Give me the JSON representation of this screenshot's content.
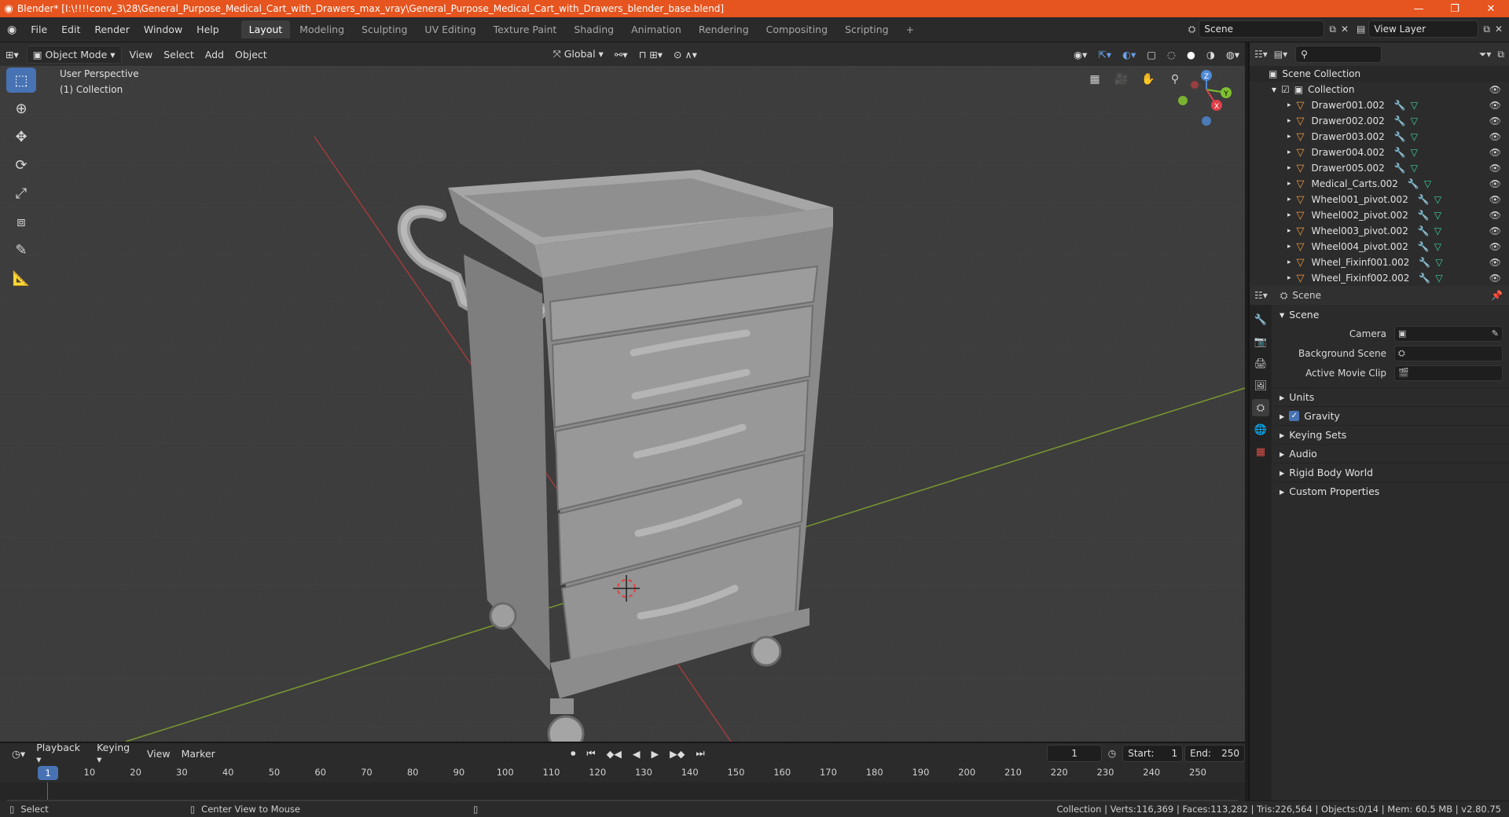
{
  "window": {
    "title": "Blender* [I:\\!!!!conv_3\\28\\General_Purpose_Medical_Cart_with_Drawers_max_vray\\General_Purpose_Medical_Cart_with_Drawers_blender_base.blend]",
    "controls": {
      "minimize": "—",
      "maximize": "❐",
      "close": "✕"
    }
  },
  "menu": [
    "File",
    "Edit",
    "Render",
    "Window",
    "Help"
  ],
  "workspaces": [
    "Layout",
    "Modeling",
    "Sculpting",
    "UV Editing",
    "Texture Paint",
    "Shading",
    "Animation",
    "Rendering",
    "Compositing",
    "Scripting"
  ],
  "active_workspace": "Layout",
  "add_workspace": "+",
  "scene_field": "Scene",
  "view_layer_field": "View Layer",
  "viewport_header": {
    "mode": "Object Mode",
    "menus": [
      "View",
      "Select",
      "Add",
      "Object"
    ],
    "orientation": "Global"
  },
  "viewport": {
    "perspective": "User Perspective",
    "collection": "(1) Collection",
    "gizmo": {
      "x": "X",
      "y": "Y",
      "z": "Z"
    }
  },
  "outliner": {
    "search_placeholder": "",
    "scene_collection": "Scene Collection",
    "collection": "Collection",
    "objects": [
      "Drawer001.002",
      "Drawer002.002",
      "Drawer003.002",
      "Drawer004.002",
      "Drawer005.002",
      "Medical_Carts.002",
      "Wheel001_pivot.002",
      "Wheel002_pivot.002",
      "Wheel003_pivot.002",
      "Wheel004_pivot.002",
      "Wheel_Fixinf001.002",
      "Wheel_Fixinf002.002"
    ]
  },
  "properties": {
    "header": "Scene",
    "panel": "Scene",
    "camera_label": "Camera",
    "background_scene_label": "Background Scene",
    "active_movie_clip_label": "Active Movie Clip",
    "subpanels": [
      "Units",
      "Gravity",
      "Keying Sets",
      "Audio",
      "Rigid Body World",
      "Custom Properties"
    ],
    "gravity_checked": true
  },
  "timeline": {
    "menus": [
      "Playback",
      "Keying",
      "View",
      "Marker"
    ],
    "current_frame": "1",
    "start_label": "Start:",
    "start": "1",
    "end_label": "End:",
    "end": "250",
    "ticks": [
      "1",
      "10",
      "20",
      "30",
      "40",
      "50",
      "60",
      "70",
      "80",
      "90",
      "100",
      "110",
      "120",
      "130",
      "140",
      "150",
      "160",
      "170",
      "180",
      "190",
      "200",
      "210",
      "220",
      "230",
      "240",
      "250"
    ]
  },
  "statusbar": {
    "select": "Select",
    "center_view": "Center View to Mouse",
    "stats": "Collection | Verts:116,369 | Faces:113,282 | Tris:226,564 | Objects:0/14 | Mem: 60.5 MB | v2.80.75"
  },
  "colors": {
    "titlebar": "#e6541f",
    "accent": "#4772b3",
    "object_icon": "#f09a42"
  }
}
